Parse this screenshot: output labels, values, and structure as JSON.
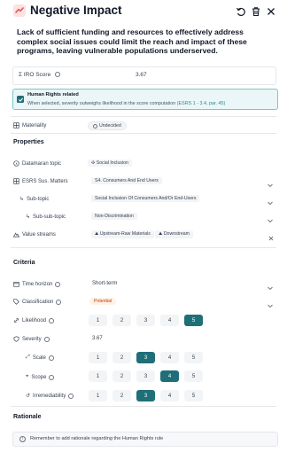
{
  "header": {
    "title": "Negative Impact",
    "icons": [
      "undo-icon",
      "trash-icon",
      "close-icon"
    ]
  },
  "description": "Lack of sufficient funding and resources to effectively address complex social issues could limit the reach and impact of these programs, leaving vulnerable populations underserved.",
  "iro": {
    "label": "IRO Score",
    "value": "3.67"
  },
  "human_rights": {
    "title": "Human Rights related",
    "text": "When selected, severity outweighs likelihood in the score computation",
    "link": "(ESRS 1 - 3.4, par. 45)",
    "checked": true
  },
  "materiality": {
    "label": "Materiality",
    "value": "Undecided"
  },
  "properties": {
    "heading": "Properties",
    "datamaran_topic": {
      "label": "Datamaran topic",
      "value": "Social Inclusion"
    },
    "esrs": {
      "label": "ESRS Sus. Matters",
      "value": "S4. Consumers And End Users"
    },
    "subtopic": {
      "label": "Sub-topic",
      "value": "Social Inclusion Of Consumers And/Or End-Users"
    },
    "subsubtopic": {
      "label": "Sub-sub-topic",
      "value": "Non-Discrimination"
    },
    "value_streams": {
      "label": "Value streams",
      "values": [
        "Upstream-Raw Materials",
        "Downstream"
      ]
    }
  },
  "criteria": {
    "heading": "Criteria",
    "time_horizon": {
      "label": "Time horizon",
      "value": "Short-term"
    },
    "classification": {
      "label": "Classification",
      "value": "Potential"
    },
    "likelihood": {
      "label": "Likelihood",
      "options": [
        "1",
        "2",
        "3",
        "4",
        "5"
      ],
      "selected": "5"
    },
    "severity": {
      "label": "Severity",
      "value": "3.67"
    },
    "scale": {
      "label": "Scale",
      "options": [
        "1",
        "2",
        "3",
        "4",
        "5"
      ],
      "selected": "3"
    },
    "scope": {
      "label": "Scope",
      "options": [
        "1",
        "2",
        "3",
        "4",
        "5"
      ],
      "selected": "4"
    },
    "irremediability": {
      "label": "Irremediability",
      "options": [
        "1",
        "2",
        "3",
        "4",
        "5"
      ],
      "selected": "3"
    }
  },
  "rationale": {
    "heading": "Rationale",
    "notice": "Remember to add rationale regarding the Human Rights rule"
  },
  "colors": {
    "accent": "#1f6f78",
    "link": "#2a8a94",
    "negative": "#e05252",
    "potential": "#c2410c"
  }
}
